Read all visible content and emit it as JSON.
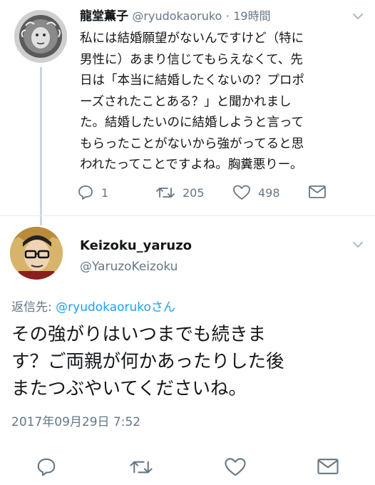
{
  "tweet1": {
    "display_name": "龍堂薫子",
    "handle": "@ryudokaoruko",
    "separator": "·",
    "time": "19時間",
    "body": "私には結婚願望がないんですけど（特に\n男性に）あまり信じてもらえなくて、先\n日は「本当に結婚したくないの？プロポ\nーズされたことある？」と聞かれまし\nた。結婚したいのに結婚しようと言って\nもらったことがないから強がってると思\nわれたってことですよね。胸糞悪りー。",
    "reply_count": "1",
    "retweet_count": "205",
    "like_count": "498",
    "icons": [
      "reply-icon",
      "retweet-icon",
      "like-icon",
      "message-icon",
      "chevron-down-icon"
    ]
  },
  "tweet2": {
    "display_name": "Keizoku_yaruzo",
    "handle": "@YaruzoKeizoku",
    "reply_prefix": "返信先: ",
    "reply_to": "@ryudokaoruko",
    "reply_suffix": "さん",
    "body": "その強がりはいつまでも続きま\nす？ご両親が何かあったりした後\nまたつぶやいてくださいね。",
    "timestamp": "2017年09月29日 7:52",
    "icons": [
      "reply-icon",
      "retweet-icon",
      "like-icon",
      "message-icon",
      "chevron-down-icon"
    ]
  },
  "colors": {
    "text": "#14171a",
    "secondary": "#657786",
    "link": "#1da1f2",
    "divider": "#e6ecf0",
    "thread_line": "#ccd6dd"
  }
}
